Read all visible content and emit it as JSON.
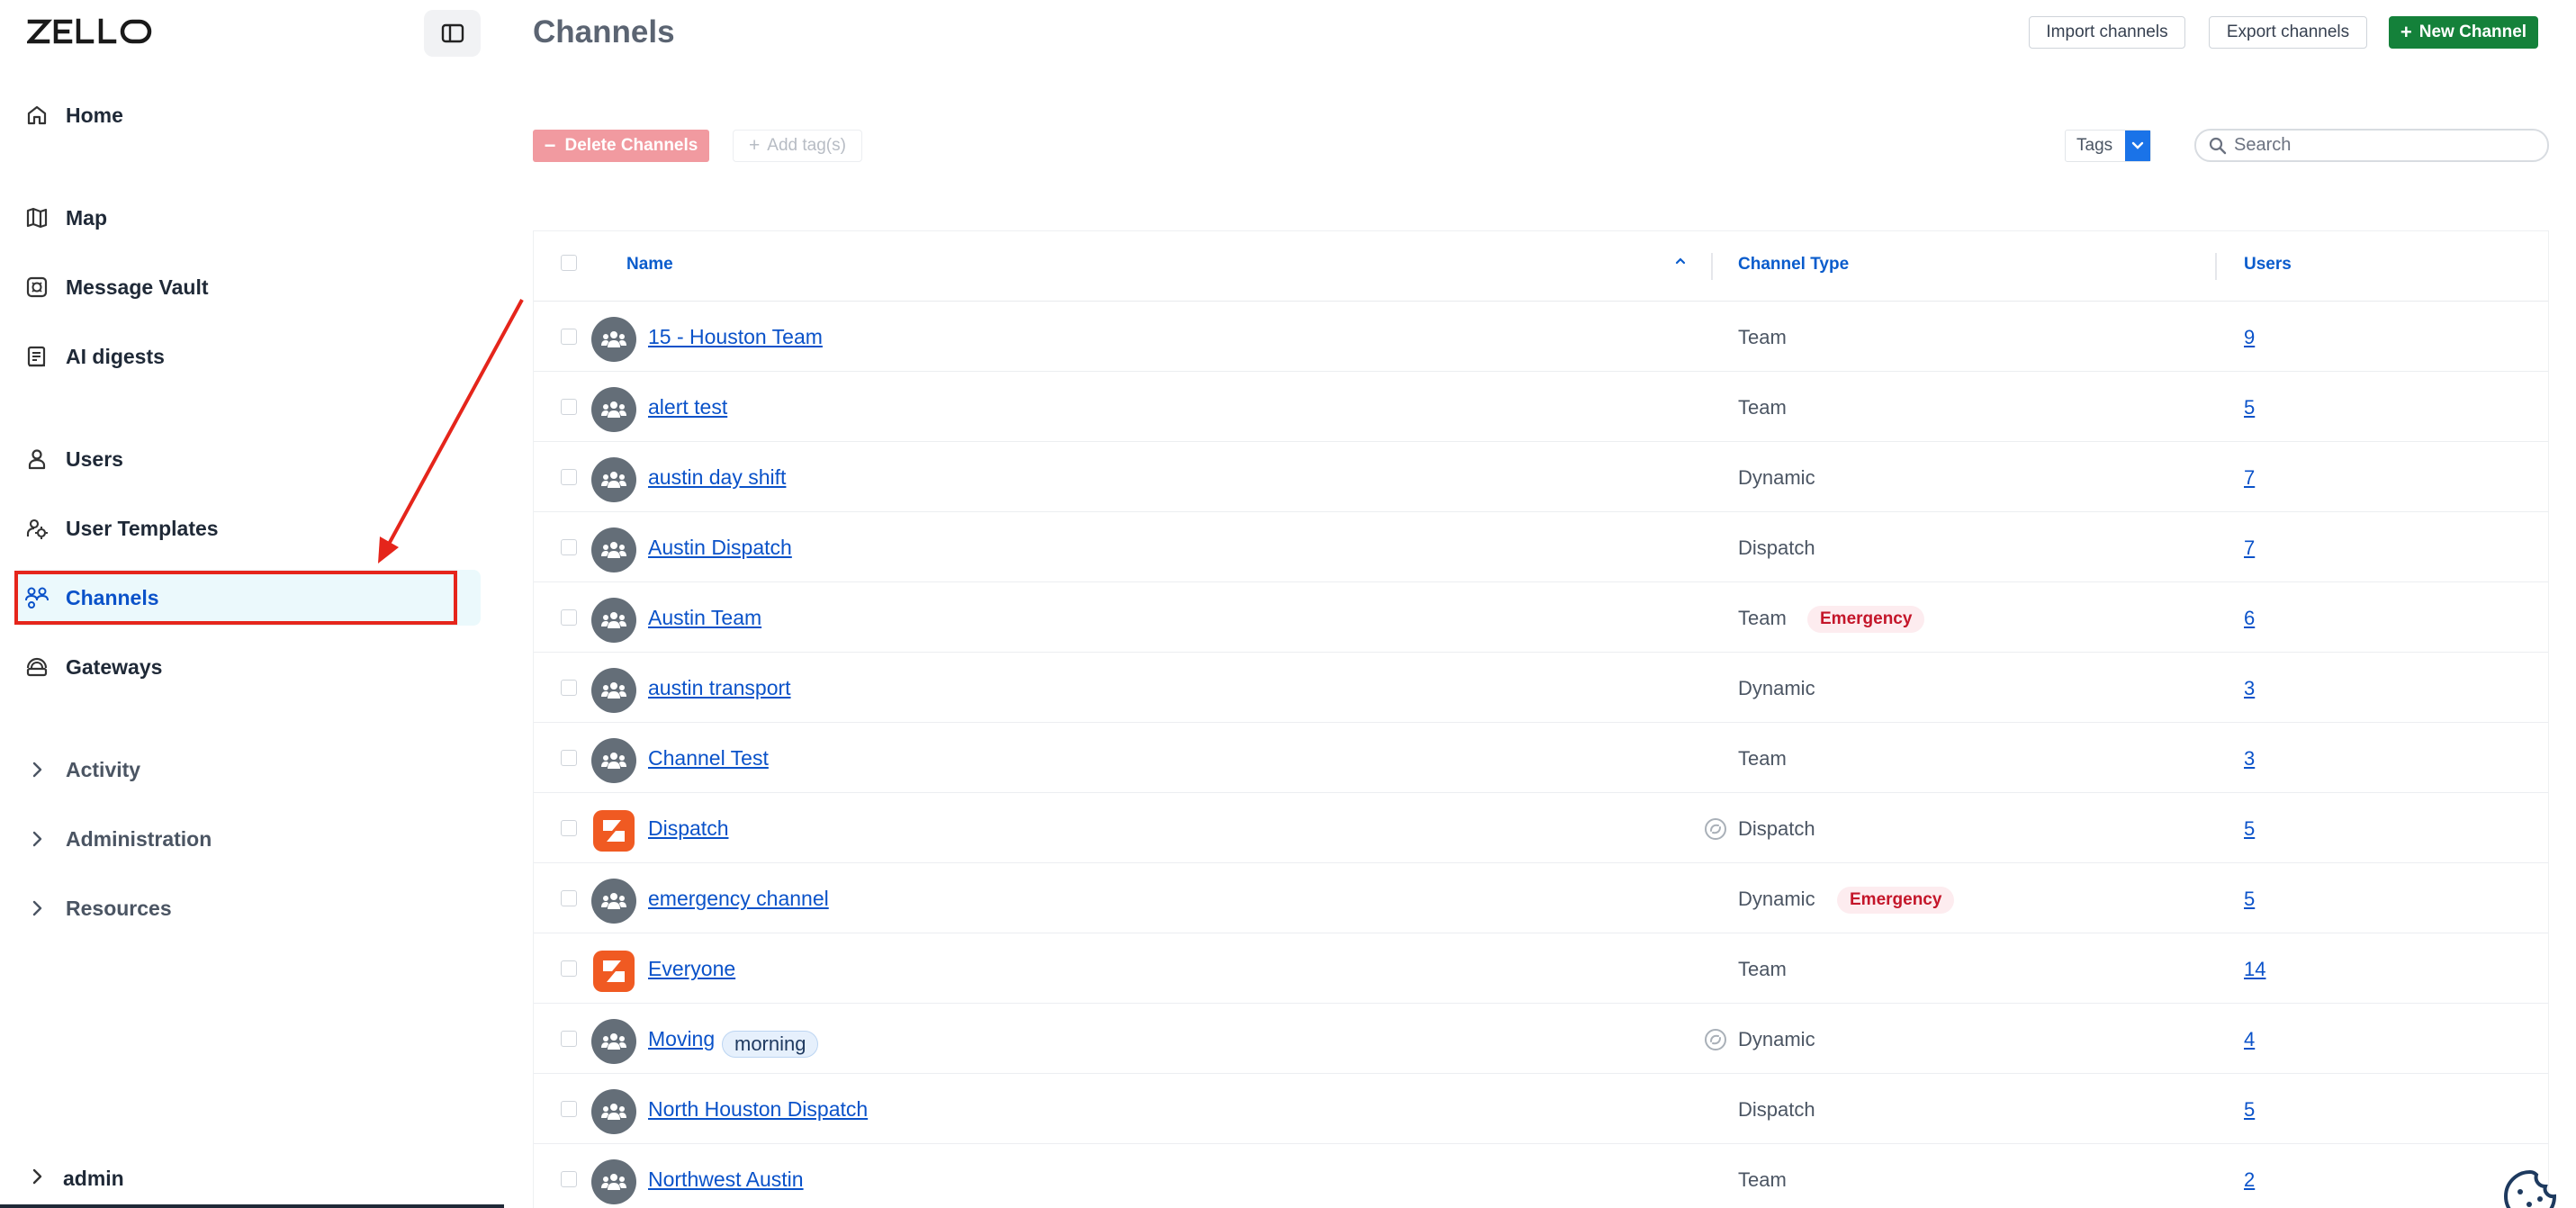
{
  "app": {
    "logo_text": "ZELLO"
  },
  "sidebar": {
    "items": [
      {
        "label": "Home",
        "icon": "home-icon"
      },
      {
        "label": "Map",
        "icon": "map-icon"
      },
      {
        "label": "Message Vault",
        "icon": "vault-icon"
      },
      {
        "label": "AI digests",
        "icon": "digest-icon"
      },
      {
        "label": "Users",
        "icon": "user-icon"
      },
      {
        "label": "User Templates",
        "icon": "user-template-icon"
      },
      {
        "label": "Channels",
        "icon": "channels-icon",
        "active": true
      },
      {
        "label": "Gateways",
        "icon": "gateway-icon"
      }
    ],
    "groups": [
      {
        "label": "Activity",
        "icon": "chevron-right-icon"
      },
      {
        "label": "Administration",
        "icon": "chevron-right-icon"
      },
      {
        "label": "Resources",
        "icon": "chevron-right-icon"
      }
    ],
    "account": {
      "label": "admin",
      "icon": "chevron-right-icon"
    }
  },
  "header": {
    "title": "Channels",
    "import_label": "Import channels",
    "export_label": "Export channels",
    "new_label": "New Channel"
  },
  "toolbar": {
    "delete_label": "Delete Channels",
    "add_tag_label": "Add tag(s)",
    "tags_label": "Tags",
    "search_placeholder": "Search"
  },
  "table": {
    "columns": {
      "name": "Name",
      "type": "Channel Type",
      "users": "Users"
    },
    "sort": {
      "column": "Name",
      "direction": "ascending"
    },
    "rows": [
      {
        "name": "15 - Houston Team",
        "type": "Team",
        "users": "9",
        "avatar": "group-icon"
      },
      {
        "name": "alert test",
        "type": "Team",
        "users": "5",
        "avatar": "group-icon"
      },
      {
        "name": "austin day shift",
        "type": "Dynamic",
        "users": "7",
        "avatar": "group-icon"
      },
      {
        "name": "Austin Dispatch",
        "type": "Dispatch",
        "users": "7",
        "avatar": "group-icon"
      },
      {
        "name": "Austin Team",
        "type": "Team",
        "users": "6",
        "avatar": "group-icon",
        "badge": "Emergency"
      },
      {
        "name": "austin transport",
        "type": "Dynamic",
        "users": "3",
        "avatar": "group-icon"
      },
      {
        "name": "Channel Test",
        "type": "Team",
        "users": "3",
        "avatar": "group-icon"
      },
      {
        "name": "Dispatch",
        "type": "Dispatch",
        "users": "5",
        "avatar": "zello-logo-icon",
        "shared": true
      },
      {
        "name": "emergency channel",
        "type": "Dynamic",
        "users": "5",
        "avatar": "group-icon",
        "badge": "Emergency"
      },
      {
        "name": "Everyone",
        "type": "Team",
        "users": "14",
        "avatar": "zello-logo-icon"
      },
      {
        "name": "Moving",
        "type": "Dynamic",
        "users": "4",
        "avatar": "group-icon",
        "tag": "morning",
        "shared": true
      },
      {
        "name": "North Houston Dispatch",
        "type": "Dispatch",
        "users": "5",
        "avatar": "group-icon"
      },
      {
        "name": "Northwest Austin",
        "type": "Team",
        "users": "2",
        "avatar": "group-icon"
      }
    ]
  },
  "colors": {
    "accent": "#0a52c9",
    "primary_button": "#14813a",
    "danger_disabled": "#f19aa0",
    "emergency": "#c4162a",
    "annotation": "#e5251b",
    "active_nav_bg": "#ebf9fc"
  }
}
